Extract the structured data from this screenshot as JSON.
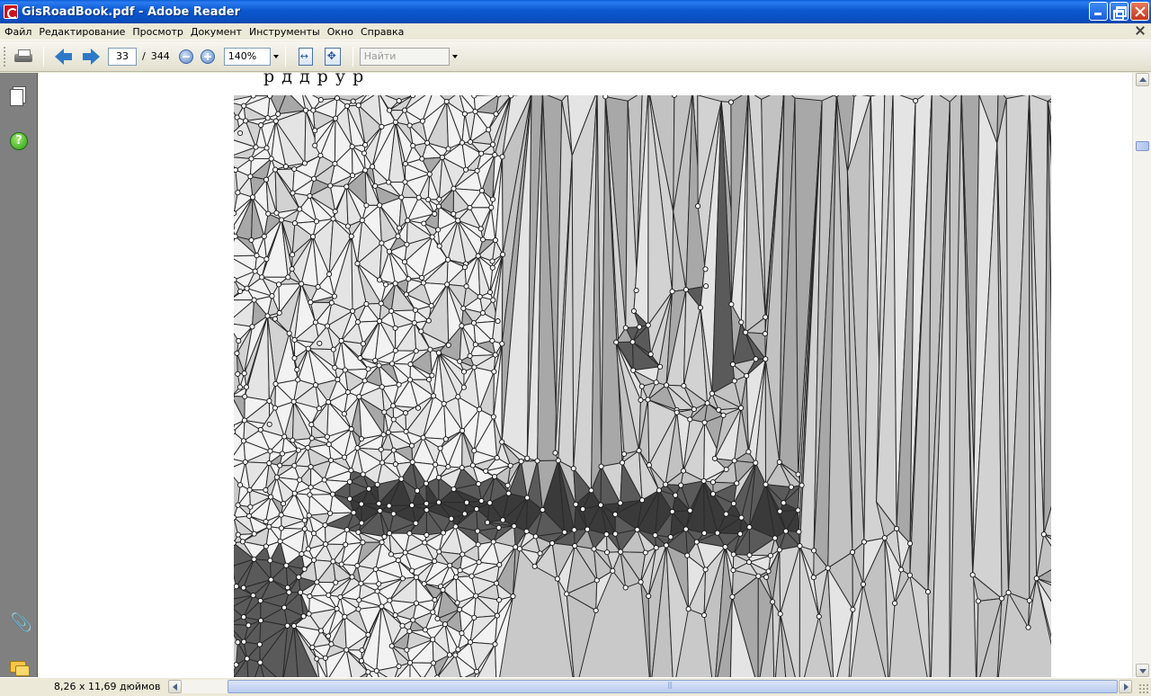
{
  "window": {
    "title": "GisRoadBook.pdf - Adobe Reader"
  },
  "menu": {
    "items": [
      "Файл",
      "Редактирование",
      "Просмотр",
      "Документ",
      "Инструменты",
      "Окно",
      "Справка"
    ]
  },
  "toolbar": {
    "current_page": "33",
    "page_separator": "/",
    "total_pages": "344",
    "zoom": "140%",
    "find_placeholder": "Найти"
  },
  "document": {
    "heading_fragment": "р  д      д          р   у р",
    "figure": {
      "description_icon": "tin-triangulation-figure",
      "fill_colors": [
        "#f2f2f2",
        "#e4e4e4",
        "#d2d2d2",
        "#c2c2c2",
        "#a8a8a8",
        "#8a8a8a",
        "#5a5a5a",
        "#3a3a3a"
      ],
      "edge_color": "#2a2a2a"
    }
  },
  "status": {
    "page_size": "8,26 x 11,69 дюймов"
  },
  "colors": {
    "titlebar": "#0b57cf",
    "chrome": "#ece9d8",
    "nav_panel": "#808080"
  }
}
